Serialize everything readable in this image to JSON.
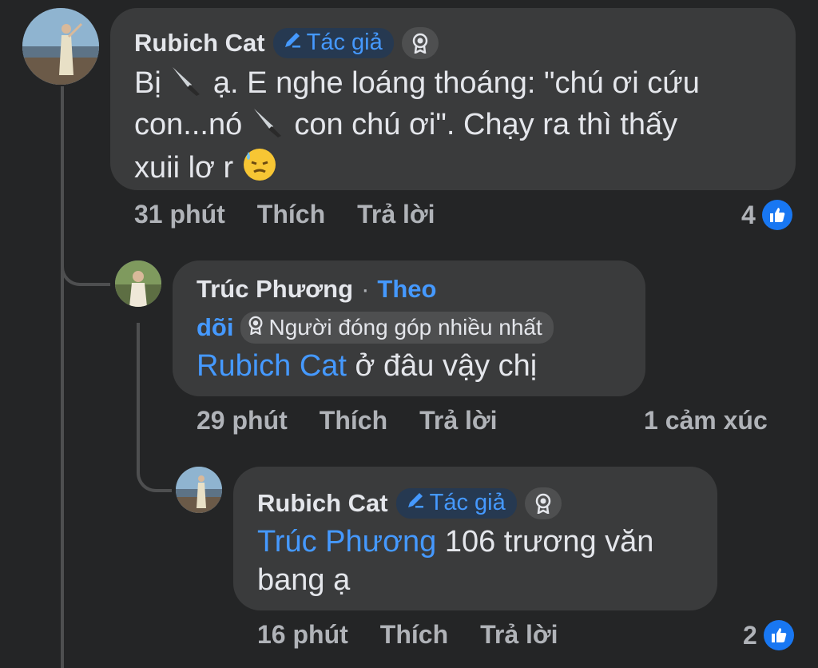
{
  "comments": [
    {
      "author": "Rubich Cat",
      "badge": "Tác giả",
      "text_parts": [
        "Bị ",
        " ạ. E nghe loáng thoáng: \"chú ơi cứu",
        "con...nó ",
        " con chú ơi\". Chạy ra thì thấy",
        "xuii lơ r "
      ],
      "time": "31 phút",
      "like_label": "Thích",
      "reply_label": "Trả lời",
      "reactions": "4"
    },
    {
      "author": "Trúc Phương",
      "dot": "·",
      "follow_label_1": "Theo",
      "follow_label_2": "dõi",
      "badge": "Người đóng góp nhiều nhất",
      "mention": "Rubich Cat",
      "text": " ở đâu vậy chị",
      "time": "29 phút",
      "like_label": "Thích",
      "reply_label": "Trả lời",
      "reactions": "1 cảm xúc"
    },
    {
      "author": "Rubich Cat",
      "badge": "Tác giả",
      "mention": "Trúc Phương",
      "text_line1": " 106 trương văn",
      "text_line2": "bang ạ",
      "time": "16 phút",
      "like_label": "Thích",
      "reply_label": "Trả lời",
      "reactions": "2"
    }
  ],
  "icons": {
    "knife": "knife-icon",
    "sweat": "downcast-sweat-face-icon",
    "pencil": "pencil-icon",
    "award": "award-icon",
    "like": "thumbs-up-icon"
  },
  "colors": {
    "background": "#242526",
    "bubble": "#3a3b3c",
    "accent": "#4599ff",
    "like_blue": "#1877f2"
  }
}
